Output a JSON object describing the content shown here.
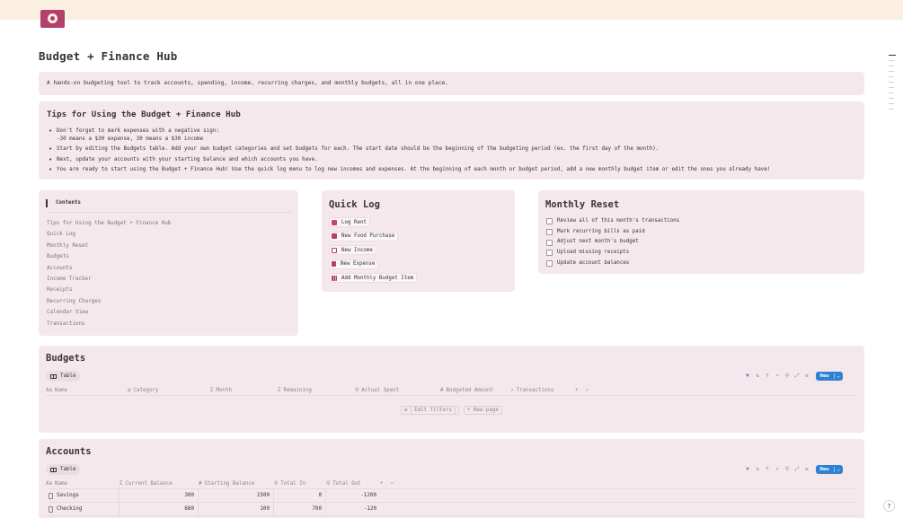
{
  "page": {
    "title": "Budget + Finance Hub",
    "description": "A hands-on budgeting tool to track accounts, spending, income, recurring charges, and monthly budgets, all in one place.",
    "help_label": "?"
  },
  "tips": {
    "heading": "Tips for Using the Budget + Finance Hub",
    "items": [
      "Don't forget to mark expenses with a negative sign:",
      "Start by editing the Budgets table. Add your own budget categories and set budgets for each. The start date should be the beginning of the budgeting period (ex. the first day of the month).",
      "Next, update your accounts with your starting balance and which accounts you have.",
      "You are ready to start using the Budget + Finance Hub! Use the quick log menu to log new incomes and expenses. At the beginning of each month or budget period, add a new monthly budget item or edit the ones you already have!"
    ],
    "sub_note": "-30 means a $30 expense, 30 means a $30 income"
  },
  "contents": {
    "heading": "Contents",
    "links": [
      "Tips for Using the Budget + Finance Hub",
      "Quick Log",
      "Monthly Reset",
      "Budgets",
      "Accounts",
      "Income Tracker",
      "Receipts",
      "Recurring Charges",
      "Calendar View",
      "Transactions"
    ]
  },
  "quick_log": {
    "heading": "Quick Log",
    "buttons": [
      {
        "label": "Log Rent",
        "icon": "house-icon",
        "color": "#c4485f"
      },
      {
        "label": "New Food Purchase",
        "icon": "food-icon",
        "color": "#b1406b"
      },
      {
        "label": "New Income",
        "icon": "money-icon",
        "color": "#b1406b"
      },
      {
        "label": "New Expense",
        "icon": "receipt-icon",
        "color": "#b1406b"
      },
      {
        "label": "Add Monthly Budget Item",
        "icon": "chart-icon",
        "color": "#b1406b"
      }
    ]
  },
  "monthly_reset": {
    "heading": "Monthly Reset",
    "items": [
      "Review all of this month's transactions",
      "Mark recurring bills as paid",
      "Adjust next month's budget",
      "Upload missing receipts",
      "Update account balances"
    ]
  },
  "budgets": {
    "heading": "Budgets",
    "view_tab": "Table",
    "new_label": "New",
    "columns": [
      {
        "icon": "Aa",
        "label": "Name"
      },
      {
        "icon": "◎",
        "label": "Category"
      },
      {
        "icon": "Σ",
        "label": "Month"
      },
      {
        "icon": "Σ",
        "label": "Remaining"
      },
      {
        "icon": "⚲",
        "label": "Actual Spent"
      },
      {
        "icon": "#",
        "label": "Budgeted Amount"
      },
      {
        "icon": "↗",
        "label": "Transactions"
      }
    ],
    "add_col": "+",
    "more": "⋯",
    "edit_filters": "Edit filters",
    "new_page": "+ New page"
  },
  "accounts": {
    "heading": "Accounts",
    "view_tab": "Table",
    "new_label": "New",
    "columns": [
      {
        "icon": "Aa",
        "label": "Name"
      },
      {
        "icon": "Σ",
        "label": "Current Balance"
      },
      {
        "icon": "#",
        "label": "Starting Balance"
      },
      {
        "icon": "⚲",
        "label": "Total In"
      },
      {
        "icon": "⚲",
        "label": "Total Out"
      }
    ],
    "add_col": "+",
    "more": "⋯",
    "rows": [
      {
        "name": "Savings",
        "current": "300",
        "starting": "1500",
        "total_in": "0",
        "total_out": "-1200"
      },
      {
        "name": "Checking",
        "current": "680",
        "starting": "100",
        "total_in": "700",
        "total_out": "-120"
      }
    ]
  },
  "toolbar_icons": [
    "filter-icon",
    "sort-icon",
    "lightning-icon",
    "search-icon",
    "search-icon",
    "expand-icon",
    "settings-icon"
  ],
  "toolbar_glyphs": [
    "▼",
    "⇅",
    "ϟ",
    "⌕",
    "⚲",
    "⤢",
    "≡"
  ]
}
